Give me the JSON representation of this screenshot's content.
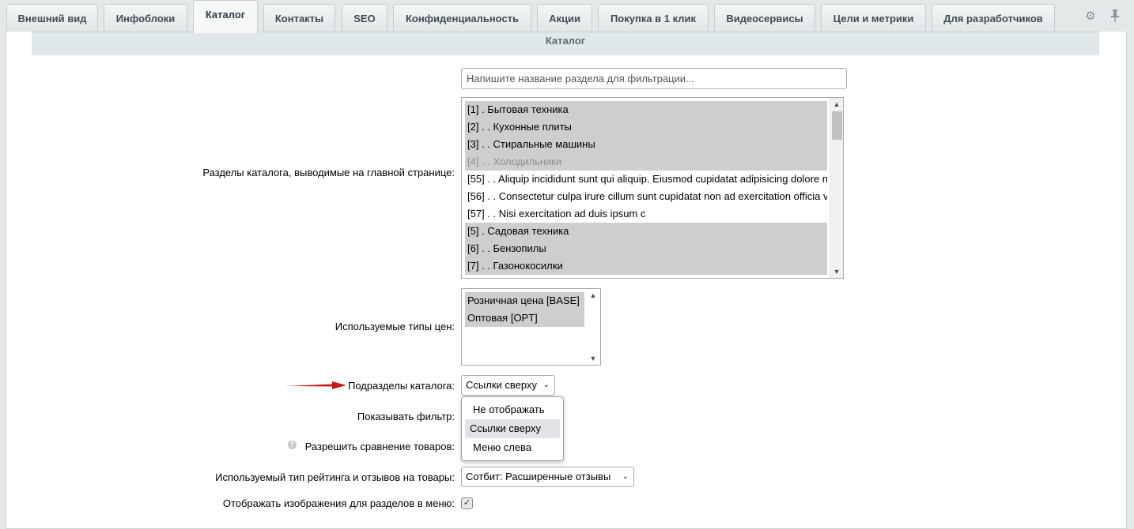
{
  "tabs": [
    {
      "label": "Внешний вид",
      "active": false
    },
    {
      "label": "Инфоблоки",
      "active": false
    },
    {
      "label": "Каталог",
      "active": true
    },
    {
      "label": "Контакты",
      "active": false
    },
    {
      "label": "SEO",
      "active": false
    },
    {
      "label": "Конфиденциальность",
      "active": false
    },
    {
      "label": "Акции",
      "active": false
    },
    {
      "label": "Покупка в 1 клик",
      "active": false
    },
    {
      "label": "Видеосервисы",
      "active": false
    },
    {
      "label": "Цели и метрики",
      "active": false
    },
    {
      "label": "Для разработчиков",
      "active": false
    }
  ],
  "toolbar_icons": [
    "gear-icon",
    "pin-icon"
  ],
  "section": {
    "title": "Каталог"
  },
  "filter": {
    "placeholder": "Напишите название раздела для фильтрации..."
  },
  "sections_field": {
    "label": "Разделы каталога, выводимые на главной странице:",
    "options": [
      {
        "text": "[1] . Бытовая техника",
        "selected": true
      },
      {
        "text": "[2] . . Кухонные плиты",
        "selected": true
      },
      {
        "text": "[3] . . Стиральные машины",
        "selected": true
      },
      {
        "text": "[4] . . Холодильники",
        "selected": true,
        "disabled": true
      },
      {
        "text": "[55] . . Aliquip incididunt sunt qui aliquip. Eiusmod cupidatat adipisicing dolore n",
        "selected": false
      },
      {
        "text": "[56] . . Consectetur culpa irure cillum sunt cupidatat non ad exercitation officia v",
        "selected": false
      },
      {
        "text": "[57] . . Nisi exercitation ad duis ipsum c",
        "selected": false
      },
      {
        "text": "[5] . Садовая техника",
        "selected": true
      },
      {
        "text": "[6] . . Бензопилы",
        "selected": true
      },
      {
        "text": "[7] . . Газонокосилки",
        "selected": true
      }
    ]
  },
  "price_types": {
    "label": "Используемые типы цен:",
    "options": [
      {
        "text": "Розничная цена [BASE]",
        "selected": true
      },
      {
        "text": "Оптовая [OPT]",
        "selected": true
      }
    ]
  },
  "subsections": {
    "label": "Подразделы каталога:",
    "value": "Ссылки сверху",
    "open_options": [
      {
        "text": "Не отображать",
        "highlighted": false
      },
      {
        "text": "Ссылки сверху",
        "highlighted": true
      },
      {
        "text": "Меню слева",
        "highlighted": false
      }
    ]
  },
  "show_filter": {
    "label": "Показывать фильтр:"
  },
  "compare": {
    "label": "Разрешить сравнение товаров:",
    "help_icon": "question-icon"
  },
  "rating": {
    "label": "Используемый тип рейтинга и отзывов на товары:",
    "value": "Сотбит: Расширенные отзывы"
  },
  "section_images": {
    "label": "Отображать изображения для разделов в меню:",
    "checked": true
  },
  "colors": {
    "accent_arrow": "#c41a1a",
    "section_bg": "#e0e8ea",
    "selected_bg": "#cecece"
  }
}
